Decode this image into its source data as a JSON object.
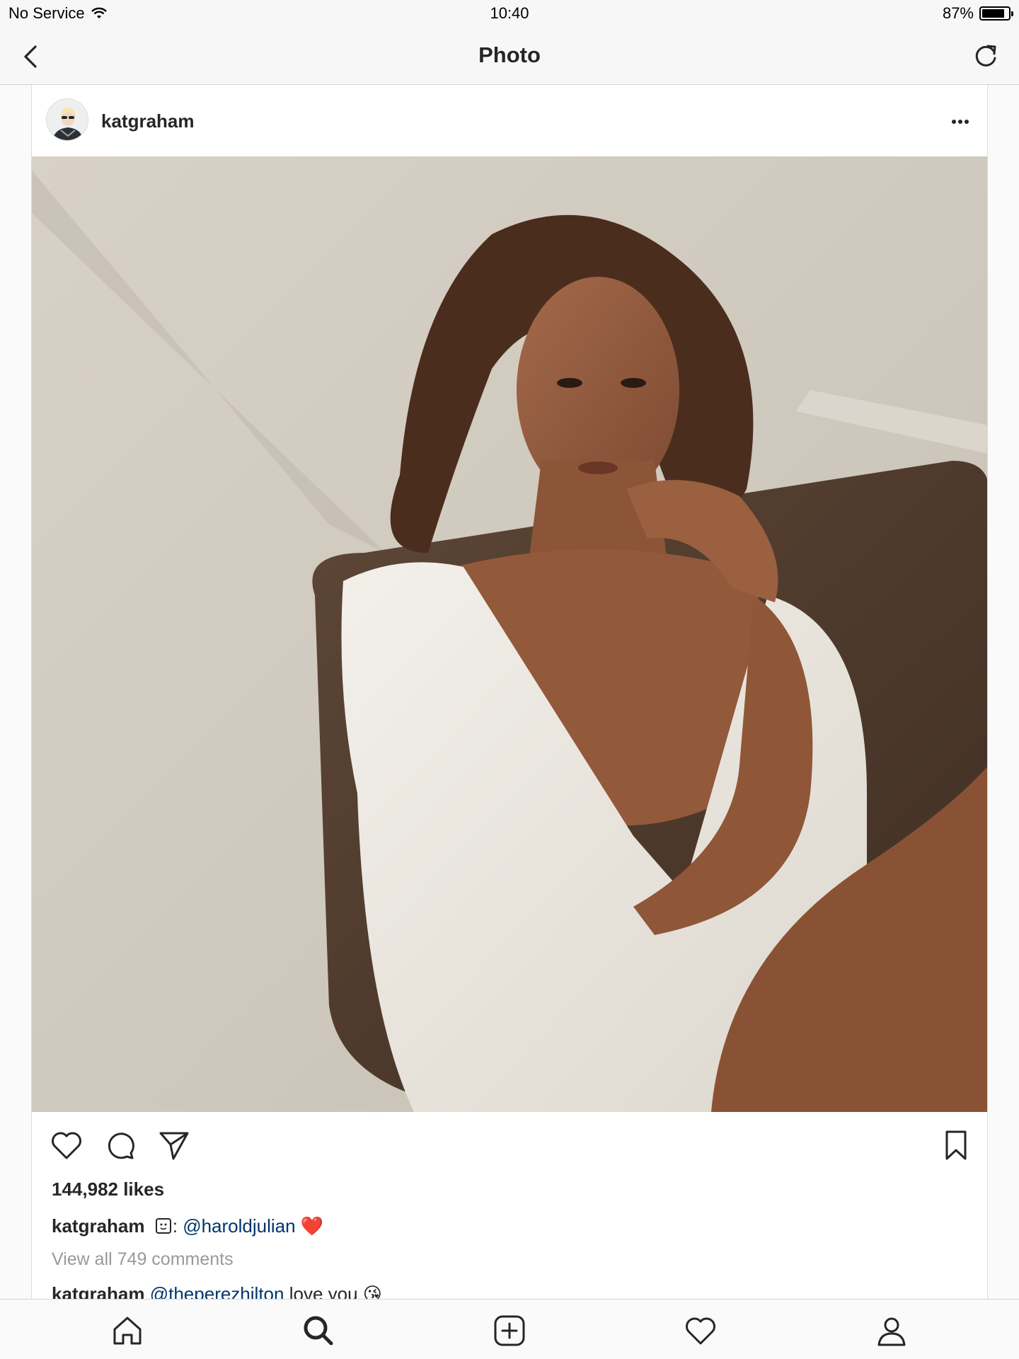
{
  "status_bar": {
    "carrier": "No Service",
    "time": "10:40",
    "battery_percent": "87%",
    "battery_level": 0.87
  },
  "nav": {
    "title": "Photo"
  },
  "post": {
    "username": "katgraham",
    "likes": "144,982 likes",
    "caption": {
      "username": "katgraham",
      "mention": "@haroldjulian",
      "emoji": "❤️"
    },
    "view_all": "View all 749 comments",
    "comment": {
      "username": "katgraham",
      "mention": "@theperezhilton",
      "text": "love you",
      "emoji": "😘"
    }
  },
  "icons": {
    "back": "chevron-left-icon",
    "refresh": "refresh-icon",
    "more": "more-options-icon",
    "like": "heart-icon",
    "comment": "comment-bubble-icon",
    "share": "paper-plane-icon",
    "save": "bookmark-icon",
    "home": "home-icon",
    "search": "search-icon",
    "add": "add-post-icon",
    "activity": "heart-icon",
    "profile": "profile-icon"
  }
}
